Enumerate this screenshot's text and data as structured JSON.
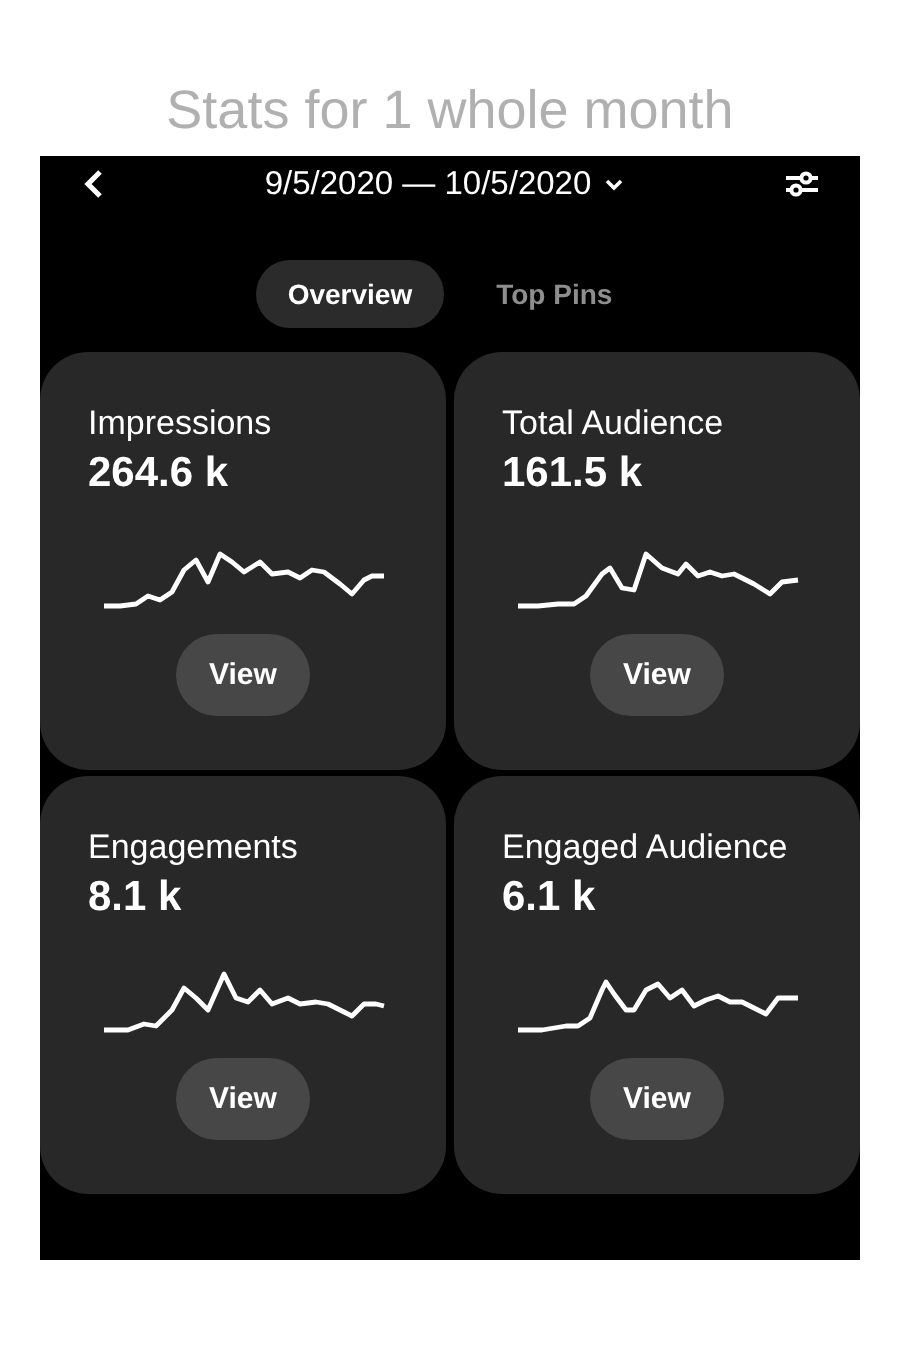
{
  "page_title": "Stats for 1 whole month",
  "header": {
    "date_range": "9/5/2020 — 10/5/2020"
  },
  "tabs": [
    {
      "label": "Overview",
      "selected": true
    },
    {
      "label": "Top Pins",
      "selected": false
    }
  ],
  "metrics": [
    {
      "label": "Impressions",
      "value": "264.6 k",
      "button": "View"
    },
    {
      "label": "Total Audience",
      "value": "161.5 k",
      "button": "View"
    },
    {
      "label": "Engagements",
      "value": "8.1 k",
      "button": "View"
    },
    {
      "label": "Engaged Audience",
      "value": "6.1 k",
      "button": "View"
    }
  ]
}
